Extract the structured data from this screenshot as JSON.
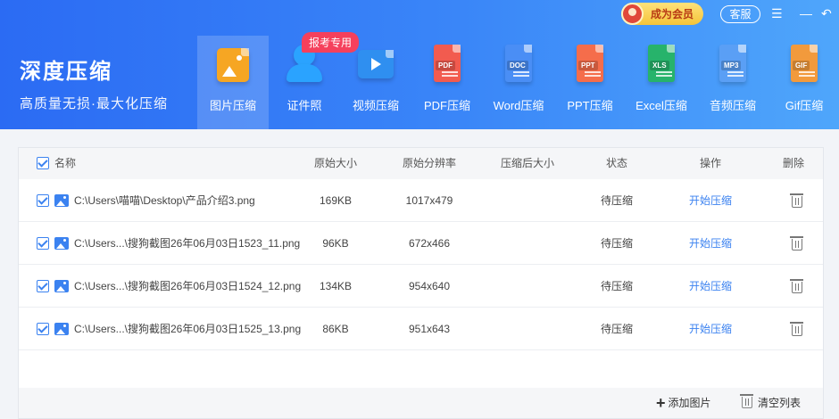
{
  "brand": {
    "title": "深度压缩",
    "subtitle": "高质量无损·最大化压缩"
  },
  "top_bar": {
    "vip_label": "成为会员",
    "service_label": "客服",
    "menu_icon": "menu-icon",
    "back_icon": "back-icon"
  },
  "exam_badge": "报考专用",
  "tools": [
    {
      "label": "图片压缩",
      "icon": "image-compress-icon",
      "color": "#f6a623",
      "active": true
    },
    {
      "label": "证件照",
      "icon": "id-photo-icon",
      "color": "#2aa3ff"
    },
    {
      "label": "视频压缩",
      "icon": "video-compress-icon",
      "color": "#2f8ff0"
    },
    {
      "label": "PDF压缩",
      "icon": "pdf-icon",
      "tag": "PDF",
      "color": "#f25b4f"
    },
    {
      "label": "Word压缩",
      "icon": "word-icon",
      "tag": "DOC",
      "color": "#4a8ef5"
    },
    {
      "label": "PPT压缩",
      "icon": "ppt-icon",
      "tag": "PPT",
      "color": "#f56d4b"
    },
    {
      "label": "Excel压缩",
      "icon": "excel-icon",
      "tag": "XLS",
      "color": "#27b36b"
    },
    {
      "label": "音频压缩",
      "icon": "audio-icon",
      "tag": "MP3",
      "color": "#5a9ff5"
    },
    {
      "label": "Gif压缩",
      "icon": "gif-icon",
      "tag": "GIF",
      "color": "#f29a3c"
    }
  ],
  "table": {
    "headers": {
      "name": "名称",
      "orig_size": "原始大小",
      "orig_res": "原始分辨率",
      "comp_size": "压缩后大小",
      "status": "状态",
      "action": "操作",
      "delete": "删除"
    },
    "rows": [
      {
        "name": "C:\\Users\\喵喵\\Desktop\\产品介绍3.png",
        "orig_size": "169KB",
        "orig_res": "1017x479",
        "comp_size": "",
        "status": "待压缩",
        "action": "开始压缩"
      },
      {
        "name": "C:\\Users...\\搜狗截图26年06月03日1523_11.png",
        "orig_size": "96KB",
        "orig_res": "672x466",
        "comp_size": "",
        "status": "待压缩",
        "action": "开始压缩"
      },
      {
        "name": "C:\\Users...\\搜狗截图26年06月03日1524_12.png",
        "orig_size": "134KB",
        "orig_res": "954x640",
        "comp_size": "",
        "status": "待压缩",
        "action": "开始压缩"
      },
      {
        "name": "C:\\Users...\\搜狗截图26年06月03日1525_13.png",
        "orig_size": "86KB",
        "orig_res": "951x643",
        "comp_size": "",
        "status": "待压缩",
        "action": "开始压缩"
      }
    ]
  },
  "footer": {
    "add_label": "添加图片",
    "clear_label": "清空列表"
  }
}
